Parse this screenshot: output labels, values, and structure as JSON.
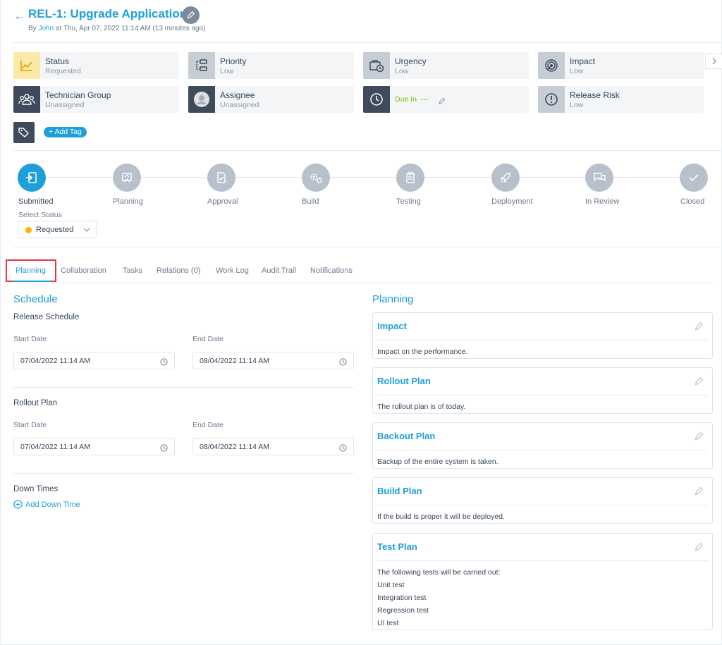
{
  "header": {
    "back_icon": "arrow-left-icon",
    "title": "REL-1: Upgrade Application",
    "meta_prefix": "By",
    "meta_user": "John",
    "meta_suffix": "at Thu, Apr 07, 2022 11:14 AM (13 minutes ago)"
  },
  "attributes": [
    {
      "label": "Status",
      "value": "Requested",
      "icon": "chart-line-icon"
    },
    {
      "label": "Priority",
      "value": "Low",
      "icon": "flow-icon"
    },
    {
      "label": "Urgency",
      "value": "Low",
      "icon": "briefcase-clock-icon"
    },
    {
      "label": "Impact",
      "value": "Low",
      "icon": "target-icon"
    },
    {
      "label": "Technician Group",
      "value": "Unassigned",
      "icon": "users-icon"
    },
    {
      "label": "Assignee",
      "value": "Unassigned",
      "icon": "avatar-icon"
    },
    {
      "label": "Due In",
      "value": "---",
      "icon": "clock-icon"
    },
    {
      "label": "Release Risk",
      "value": "Low",
      "icon": "alert-circle-icon"
    }
  ],
  "tags": {
    "add_label": "+ Add Tag"
  },
  "stages": [
    {
      "label": "Submitted",
      "icon": "submit-icon",
      "active": true
    },
    {
      "label": "Planning",
      "icon": "planning-icon"
    },
    {
      "label": "Approval",
      "icon": "approval-icon"
    },
    {
      "label": "Build",
      "icon": "gears-icon"
    },
    {
      "label": "Testing",
      "icon": "clipboard-icon"
    },
    {
      "label": "Deployment",
      "icon": "rocket-icon"
    },
    {
      "label": "In Review",
      "icon": "chat-icon"
    },
    {
      "label": "Closed",
      "icon": "check-icon"
    }
  ],
  "status_select": {
    "label": "Select Status",
    "value": "Requested",
    "color": "#f5b800"
  },
  "tabs": [
    {
      "label": "Planning",
      "active": true
    },
    {
      "label": "Collaboration"
    },
    {
      "label": "Tasks"
    },
    {
      "label": "Relations (0)"
    },
    {
      "label": "Work Log"
    },
    {
      "label": "Audit Trail"
    },
    {
      "label": "Notifications"
    }
  ],
  "schedule": {
    "title": "Schedule",
    "release_schedule": {
      "title": "Release Schedule",
      "start_label": "Start Date",
      "start_value": "07/04/2022 11:14 AM",
      "end_label": "End Date",
      "end_value": "08/04/2022 11:14 AM"
    },
    "rollout_plan": {
      "title": "Rollout Plan",
      "start_label": "Start Date",
      "start_value": "07/04/2022 11:14 AM",
      "end_label": "End Date",
      "end_value": "08/04/2022 11:14 AM"
    },
    "down_times": {
      "title": "Down Times",
      "add_label": "Add Down Time"
    }
  },
  "planning": {
    "title": "Planning",
    "sections": [
      {
        "title": "Impact",
        "lines": [
          "Impact on the performance."
        ]
      },
      {
        "title": "Rollout Plan",
        "lines": [
          "The rollout plan is of today."
        ]
      },
      {
        "title": "Backout Plan",
        "lines": [
          "Backup of the entire system is taken."
        ]
      },
      {
        "title": "Build Plan",
        "lines": [
          "If the build is proper it will be deployed."
        ]
      },
      {
        "title": "Test Plan",
        "lines": [
          "The following tests will be carried out:",
          "Unit test",
          "Integration test",
          "Regression test",
          "UI test"
        ]
      }
    ]
  },
  "colors": {
    "accent": "#1e9fd9",
    "highlight_border": "#e0393e",
    "due_green": "#79c000"
  }
}
